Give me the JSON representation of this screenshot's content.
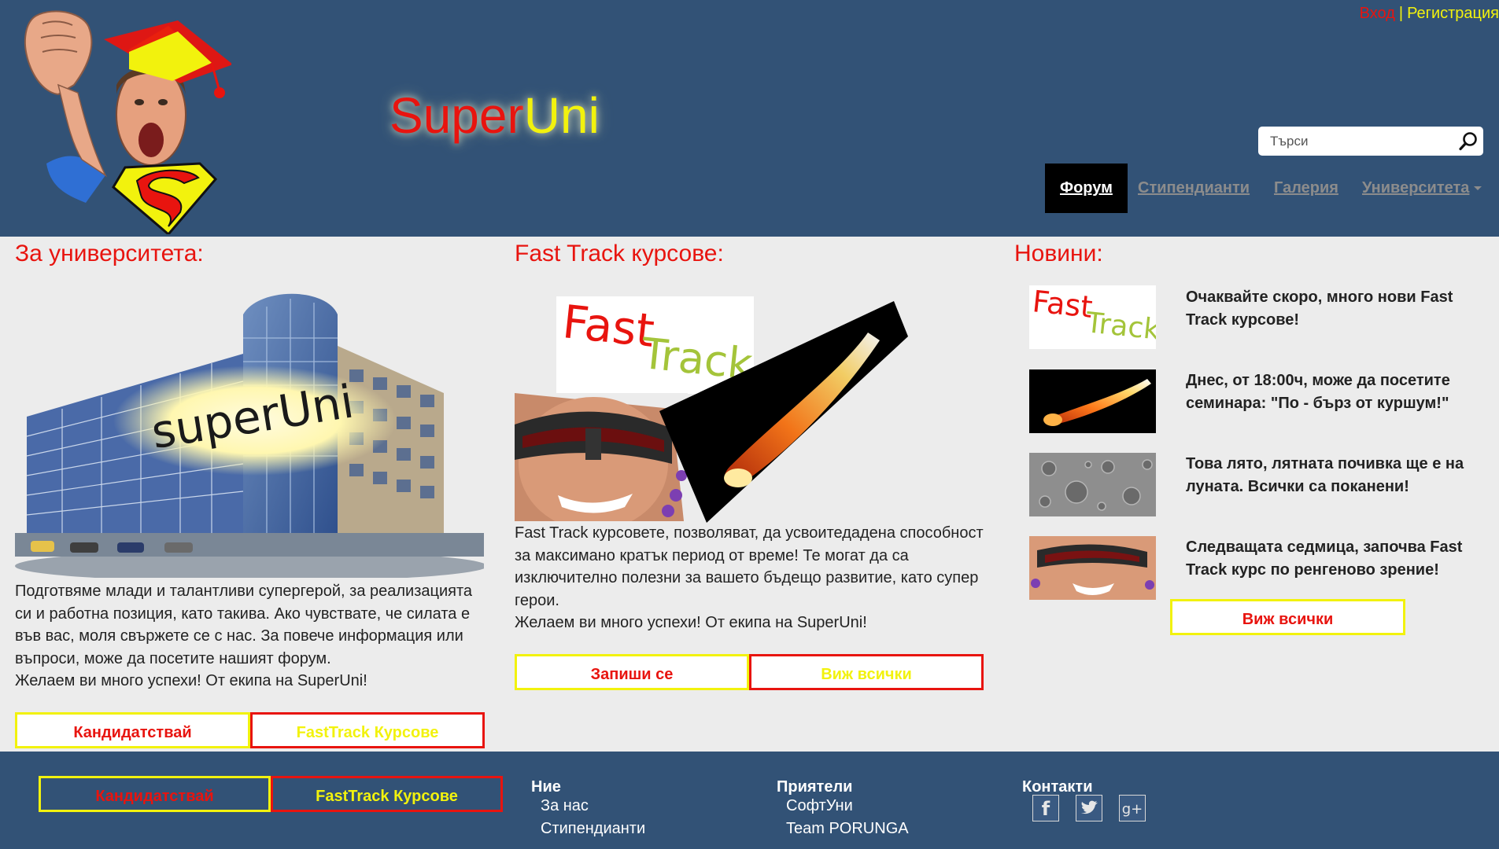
{
  "header": {
    "title_part1": "Super",
    "title_part2": "Uni",
    "auth": {
      "login": "Вход",
      "separator": "|",
      "register": "Регистрация"
    },
    "search": {
      "placeholder": "Търси"
    },
    "nav": [
      {
        "label": "Форум",
        "active": true
      },
      {
        "label": "Стипендианти",
        "active": false
      },
      {
        "label": "Галерия",
        "active": false
      },
      {
        "label": "Университета",
        "active": false,
        "dropdown": true
      }
    ]
  },
  "colors": {
    "header_bg": "#325276",
    "red": "#e8140f",
    "yellow": "#f2f20d",
    "page_bg": "#ececec"
  },
  "about": {
    "title": "За университета:",
    "image_caption": "superUni",
    "text": [
      "Подготвяме млади и талантливи супергерой, за реализацията",
      "си и работна позиция, като такива. Ако чувствате, че силата е",
      "във вас, моля свържете се с нас. За повече информация или",
      "въпроси, може да посетите нашият форум.",
      "Желаем ви много успехи! От екипа на SuperUni!"
    ],
    "btn_apply": "Кандидатствай",
    "btn_courses": "FastTrack Курсове"
  },
  "fasttrack": {
    "title": "Fast Track курсове:",
    "logo_fast": "Fast",
    "logo_track": "Track",
    "text": [
      "Fast Track курсовете, позволяват, да усвоитедадена способност",
      "за максимано кратък период от време! Те могат да са",
      "изключително полезни за вашето бъдещо развитие, като супер",
      "герои.",
      "Желаем ви много успехи! От екипа на SuperUni!"
    ],
    "btn_enroll": "Запиши се",
    "btn_view_all": "Виж всички"
  },
  "news": {
    "title": "Новини:",
    "items": [
      {
        "icon": "fasttrack-logo-thumb",
        "lines": [
          "Очаквайте скоро, много нови Fast",
          "Track курсове!"
        ]
      },
      {
        "icon": "meteor-thumb",
        "lines": [
          "Днес, от 18:00ч, може да посетите",
          "семинара: \"По - бърз от куршум!\""
        ]
      },
      {
        "icon": "moon-thumb",
        "lines": [
          "Това лято, лятната почивка ще е на",
          "луната. Всички са поканени!"
        ]
      },
      {
        "icon": "visor-man-thumb",
        "lines": [
          "Следващата седмица, започва Fast",
          "Track курс по ренгеново зрение!"
        ]
      }
    ],
    "btn_view_all": "Виж всички"
  },
  "footer": {
    "btn_apply": "Кандидатствай",
    "btn_courses": "FastTrack Курсове",
    "col_us": {
      "title": "Ние",
      "links": [
        "За нас",
        "Стипендианти"
      ]
    },
    "col_friends": {
      "title": "Приятели",
      "links": [
        "СофтУни",
        "Team PORUNGA"
      ]
    },
    "col_contacts": {
      "title": "Контакти",
      "icons": [
        "facebook-icon",
        "twitter-icon",
        "google-plus-icon"
      ]
    },
    "social_text": {
      "facebook": "f",
      "googleplus": "g+"
    }
  }
}
